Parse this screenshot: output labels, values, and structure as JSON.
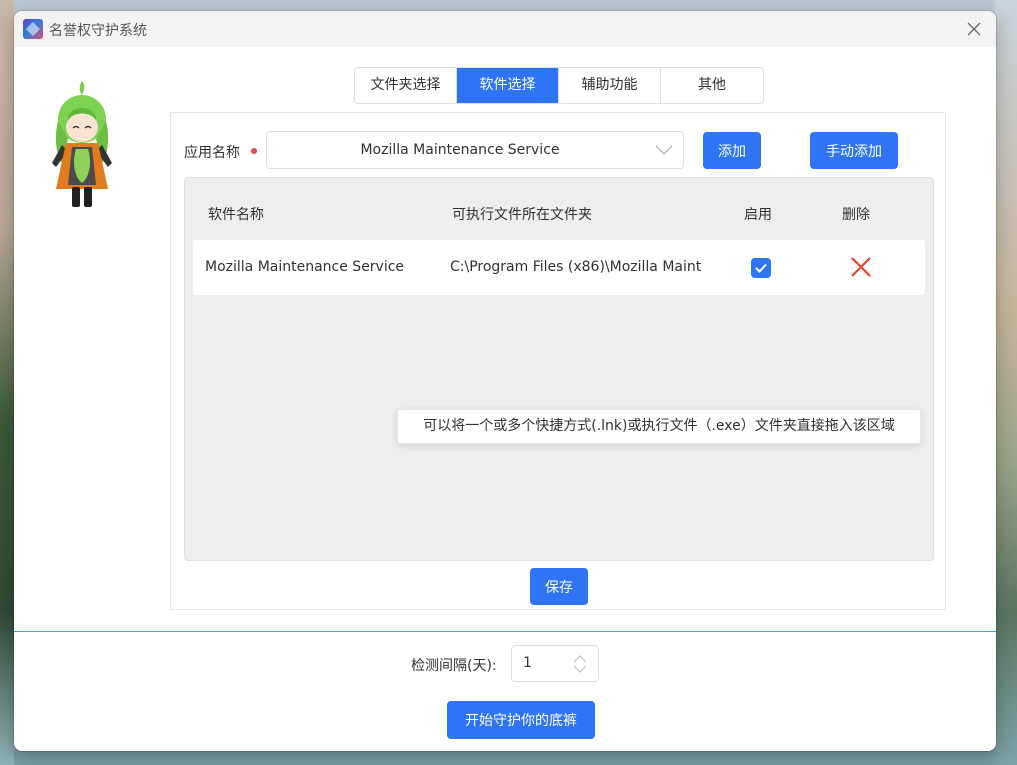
{
  "window": {
    "title": "名誉权守护系统"
  },
  "tabs": [
    {
      "label": "文件夹选择",
      "active": false
    },
    {
      "label": "软件选择",
      "active": true
    },
    {
      "label": "辅助功能",
      "active": false
    },
    {
      "label": "其他",
      "active": false
    }
  ],
  "app_selector": {
    "label": "应用名称",
    "selected": "Mozilla Maintenance Service",
    "add_label": "添加",
    "manual_add_label": "手动添加"
  },
  "table": {
    "headers": {
      "name": "软件名称",
      "path": "可执行文件所在文件夹",
      "enabled": "启用",
      "delete": "删除"
    },
    "rows": [
      {
        "name": "Mozilla Maintenance Service",
        "path": "C:\\Program Files (x86)\\Mozilla Maint",
        "enabled": true
      }
    ],
    "drop_hint": "可以将一个或多个快捷方式(.lnk)或执行文件（.exe）文件夹直接拖入该区域"
  },
  "save_label": "保存",
  "interval": {
    "label": "检测间隔(天):",
    "value": "1"
  },
  "start_label": "开始守护你的底裤",
  "colors": {
    "accent": "#2f74f5",
    "delete": "#e8462c",
    "divider": "#2aa7d8"
  }
}
